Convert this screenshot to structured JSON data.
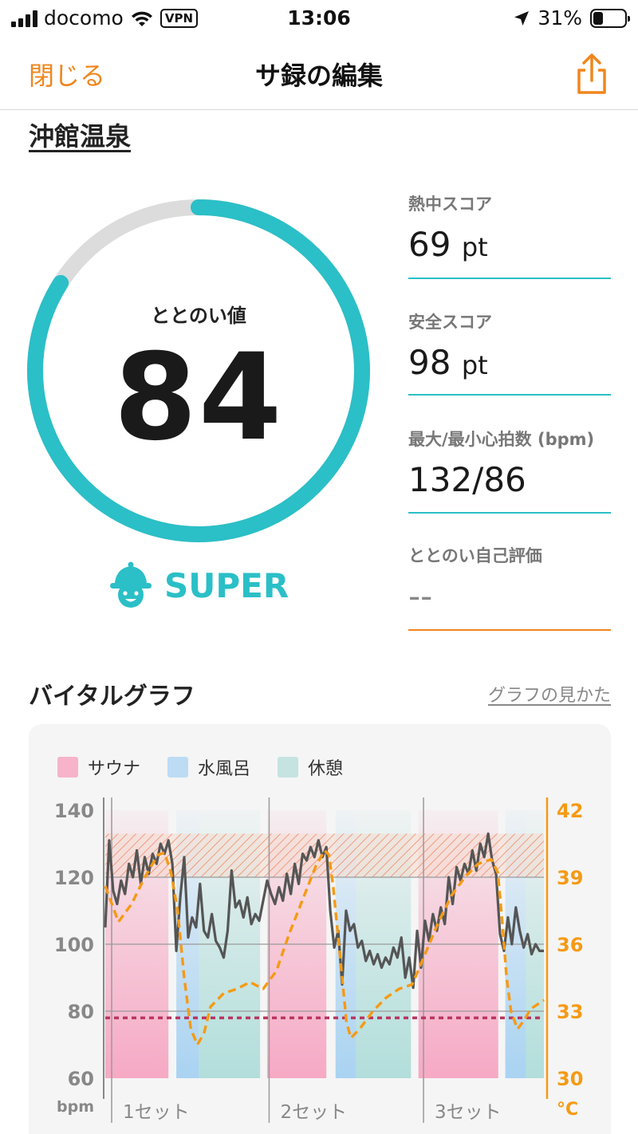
{
  "status_bar": {
    "carrier": "docomo",
    "vpn": "VPN",
    "time": "13:06",
    "battery": "31%",
    "battery_level": 0.31
  },
  "nav": {
    "close": "閉じる",
    "title": "サ録の編集",
    "share_icon": "share-icon"
  },
  "facility": "沖館温泉",
  "gauge": {
    "label": "ととのい値",
    "value": "84",
    "progress": 0.84,
    "rank": "SUPER",
    "rank_icon": "sauna-hat-face-icon"
  },
  "stats": [
    {
      "label": "熱中スコア",
      "value": "69",
      "unit": "pt"
    },
    {
      "label": "安全スコア",
      "value": "98",
      "unit": "pt"
    },
    {
      "label": "最大/最小心拍数 (bpm)",
      "value": "132/86",
      "unit": ""
    },
    {
      "label": "ととのい自己評価",
      "value": "--",
      "unit": ""
    }
  ],
  "colors": {
    "accent_orange": "#f0861e",
    "accent_teal": "#2bbfc7",
    "sauna": "#f6a9c4",
    "water": "#a9d3f2",
    "rest": "#b2dedb",
    "hr_line": "#555555",
    "temp_line": "#f59a14",
    "threshold": "#b8365f"
  },
  "graph": {
    "title": "バイタルグラフ",
    "help_link": "グラフの見かた",
    "chart_data": {
      "type": "line",
      "legend": [
        {
          "name": "サウナ",
          "color": "#f6a9c4"
        },
        {
          "name": "水風呂",
          "color": "#a9d3f2"
        },
        {
          "name": "休憩",
          "color": "#b2dedb"
        }
      ],
      "y_left": {
        "label": "bpm",
        "ticks": [
          60,
          80,
          100,
          120,
          140
        ],
        "range": [
          60,
          140
        ]
      },
      "y_right": {
        "label": "°C",
        "ticks": [
          30,
          33,
          36,
          39,
          42
        ],
        "range": [
          30,
          42
        ]
      },
      "set_labels": [
        "1セット",
        "2セット",
        "3セット"
      ],
      "x_range": [
        0,
        100
      ],
      "phases": [
        {
          "type": "sauna",
          "start": 0,
          "end": 14.4
        },
        {
          "type": "water",
          "start": 16.2,
          "end": 21.4
        },
        {
          "type": "rest",
          "start": 21.4,
          "end": 35.3
        },
        {
          "type": "sauna",
          "start": 36.9,
          "end": 50.4
        },
        {
          "type": "water",
          "start": 52.5,
          "end": 57.2
        },
        {
          "type": "rest",
          "start": 57.2,
          "end": 69.7
        },
        {
          "type": "sauna",
          "start": 71.4,
          "end": 89.6
        },
        {
          "type": "water",
          "start": 91.2,
          "end": 95.9
        },
        {
          "type": "rest",
          "start": 95.9,
          "end": 100
        }
      ],
      "hr_zone": [
        120,
        133
      ],
      "threshold_bpm": 78,
      "heart_rate": {
        "x": [
          0,
          0.9,
          1.8,
          2.7,
          3.6,
          4.5,
          5.4,
          6.3,
          7.2,
          8.1,
          9.0,
          9.9,
          10.8,
          11.7,
          12.6,
          13.5,
          14.4,
          15.3,
          16.2,
          17.1,
          18.0,
          18.9,
          19.8,
          20.7,
          21.6,
          22.5,
          23.4,
          24.3,
          25.2,
          26.1,
          27.0,
          27.9,
          28.8,
          29.7,
          30.6,
          31.5,
          32.4,
          33.3,
          34.2,
          35.1,
          36.0,
          36.9,
          37.8,
          38.7,
          39.6,
          40.5,
          41.4,
          42.3,
          43.2,
          44.1,
          45.0,
          45.9,
          46.8,
          47.7,
          48.6,
          49.5,
          50.4,
          51.3,
          52.2,
          53.1,
          54.0,
          54.9,
          55.8,
          56.7,
          57.6,
          58.5,
          59.4,
          60.3,
          61.2,
          62.1,
          63.0,
          63.9,
          64.8,
          65.7,
          66.6,
          67.5,
          68.4,
          69.3,
          70.2,
          71.1,
          72.0,
          72.9,
          73.8,
          74.7,
          75.6,
          76.5,
          77.4,
          78.3,
          79.2,
          80.1,
          81.0,
          81.9,
          82.8,
          83.7,
          84.6,
          85.5,
          86.4,
          87.3,
          88.2,
          89.1,
          90.0,
          90.9,
          91.8,
          92.7,
          93.6,
          94.5,
          95.4,
          96.3,
          97.2,
          98.1,
          99.0,
          100
        ],
        "y": [
          105,
          131,
          116,
          112,
          119,
          115,
          124,
          120,
          128,
          118,
          126,
          121,
          127,
          124,
          130,
          127,
          131,
          124,
          98,
          114,
          126,
          102,
          108,
          105,
          118,
          104,
          102,
          109,
          101,
          99,
          96,
          104,
          122,
          111,
          113,
          108,
          114,
          106,
          109,
          107,
          113,
          119,
          115,
          112,
          117,
          113,
          121,
          115,
          124,
          118,
          127,
          125,
          129,
          126,
          131,
          126,
          129,
          110,
          99,
          104,
          88,
          110,
          104,
          106,
          99,
          101,
          95,
          98,
          94,
          97,
          93,
          96,
          94,
          99,
          96,
          102,
          90,
          96,
          87,
          104,
          93,
          107,
          101,
          109,
          104,
          111,
          106,
          120,
          112,
          123,
          119,
          124,
          121,
          128,
          122,
          130,
          126,
          133,
          125,
          121,
          103,
          98,
          108,
          100,
          111,
          104,
          99,
          103,
          97,
          100,
          98,
          98
        ],
        "max": 132,
        "min": 86
      },
      "temperature": {
        "x": [
          0,
          3,
          6,
          9,
          12,
          13.5,
          15,
          16.5,
          18,
          19.5,
          21,
          22.5,
          24,
          27,
          30,
          33,
          36,
          39,
          42,
          45,
          48,
          50,
          51,
          52,
          53.5,
          55,
          56,
          58,
          61,
          64,
          67,
          70,
          73,
          76,
          79,
          82,
          85,
          88,
          89.5,
          90.5,
          91.5,
          92.5,
          94,
          95.5,
          97,
          98.5,
          100
        ],
        "y": [
          38.6,
          37,
          37.8,
          39,
          40,
          40.1,
          39.2,
          37.5,
          34.5,
          32.2,
          31.5,
          32,
          33.2,
          33.8,
          34,
          34.3,
          34,
          34.8,
          36.5,
          38,
          39.5,
          40.2,
          40,
          38.5,
          35.5,
          32.5,
          31.8,
          32.2,
          33,
          33.6,
          34,
          34.2,
          35.6,
          37,
          38.2,
          39,
          39.6,
          39.8,
          39.2,
          37,
          34.5,
          33,
          32.2,
          32.6,
          33.1,
          33.3,
          33.5
        ]
      }
    }
  }
}
